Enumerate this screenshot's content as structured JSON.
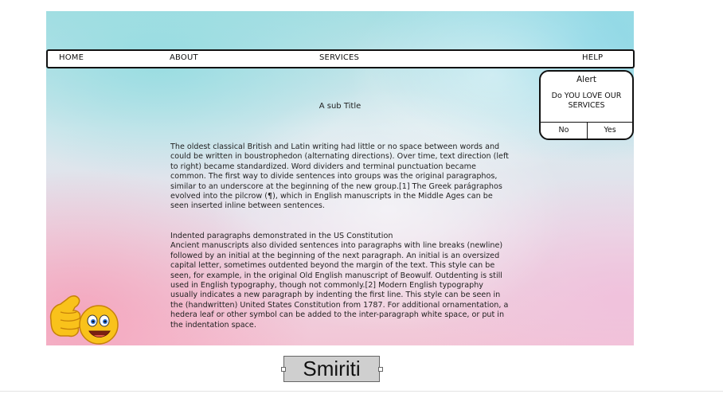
{
  "nav": {
    "items": [
      {
        "label": "HOME"
      },
      {
        "label": "ABOUT"
      },
      {
        "label": "SERVICES"
      },
      {
        "label": "HELP"
      }
    ]
  },
  "main": {
    "subtitle": "A sub Title",
    "paragraph1": "The oldest classical British and Latin writing had little or no space between words and could be written in boustrophedon (alternating directions). Over time, text direction (left to right) became standardized. Word dividers and terminal punctuation became common. The first way to divide sentences into groups was the original paragraphos, similar to an underscore at the beginning of the new group.[1] The Greek parágraphos evolved into the pilcrow (¶), which in English manuscripts in the Middle Ages can be seen inserted inline between sentences.",
    "paragraph2_heading": "Indented paragraphs demonstrated in the US Constitution",
    "paragraph2": "Ancient manuscripts also divided sentences into paragraphs with line breaks (newline) followed by an initial at the beginning of the next paragraph. An initial is an oversized capital letter, sometimes outdented beyond the margin of the text. This style can be seen, for example, in the original Old English manuscript of Beowulf. Outdenting is still used in English typography, though not commonly.[2] Modern English typography usually indicates a new paragraph by indenting the first line. This style can be seen in the (handwritten) United States Constitution from 1787. For additional ornamentation, a hedera leaf or other symbol can be added to the inter-paragraph white space, or put in the indentation space."
  },
  "alert": {
    "title": "Alert",
    "message": "Do YOU LOVE OUR SERVICES",
    "no_label": "No",
    "yes_label": "Yes"
  },
  "footer": {
    "name": "Smiriti"
  },
  "icons": {
    "emoji": "thumbs-up-smiley-icon"
  },
  "colors": {
    "hero_top": "#a6dfe3",
    "hero_bottom": "#f3c6d6",
    "emoji_yellow": "#f9c21b",
    "name_box": "#cfcfcf"
  }
}
